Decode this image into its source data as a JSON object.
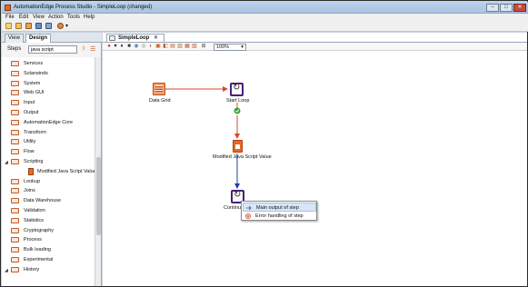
{
  "window": {
    "title": "AutomationEdge Process Studio - SimpleLoop (changed)",
    "minimize": "–",
    "maximize": "□",
    "close": "✕"
  },
  "menu": [
    "File",
    "Edit",
    "View",
    "Action",
    "Tools",
    "Help"
  ],
  "left_panel": {
    "tabs": [
      "View",
      "Design"
    ],
    "active_tab": "Design",
    "steps_label": "Steps",
    "search_value": "java script",
    "tree": [
      {
        "label": "Services",
        "type": "folder",
        "expanded": false
      },
      {
        "label": "Solarwinds",
        "type": "folder",
        "expanded": false
      },
      {
        "label": "System",
        "type": "folder",
        "expanded": false
      },
      {
        "label": "Web GUI",
        "type": "folder",
        "expanded": false
      },
      {
        "label": "Input",
        "type": "folder",
        "expanded": false
      },
      {
        "label": "Output",
        "type": "folder",
        "expanded": false
      },
      {
        "label": "AutomationEdge Core",
        "type": "folder",
        "expanded": false
      },
      {
        "label": "Transform",
        "type": "folder",
        "expanded": false
      },
      {
        "label": "Utility",
        "type": "folder",
        "expanded": false
      },
      {
        "label": "Flow",
        "type": "folder",
        "expanded": false
      },
      {
        "label": "Scripting",
        "type": "folder",
        "expanded": true
      },
      {
        "label": "Modified Java Script Value",
        "type": "step",
        "expanded": false
      },
      {
        "label": "Lookup",
        "type": "folder",
        "expanded": false
      },
      {
        "label": "Joins",
        "type": "folder",
        "expanded": false
      },
      {
        "label": "Data Warehouse",
        "type": "folder",
        "expanded": false
      },
      {
        "label": "Validation",
        "type": "folder",
        "expanded": false
      },
      {
        "label": "Statistics",
        "type": "folder",
        "expanded": false
      },
      {
        "label": "Cryptography",
        "type": "folder",
        "expanded": false
      },
      {
        "label": "Process",
        "type": "folder",
        "expanded": false
      },
      {
        "label": "Bulk loading",
        "type": "folder",
        "expanded": false
      },
      {
        "label": "Experimental",
        "type": "folder",
        "expanded": false
      },
      {
        "label": "History",
        "type": "folder",
        "expanded": true
      }
    ]
  },
  "editor": {
    "tab_label": "SimpleLoop",
    "zoom": "100%",
    "nodes": {
      "data_grid": "Data Grid",
      "start_loop": "Start Loop",
      "modified_js": "Modified Java Script Value",
      "continue": "Continue"
    },
    "context_menu": [
      "Main output of step",
      "Error handling of step"
    ]
  },
  "colors": {
    "accent": "#e26a2c",
    "loop_node": "#4a1f78",
    "ok_green": "#3aa53a",
    "hop_red": "#d9482b",
    "hop_blue": "#1f3fa8"
  }
}
